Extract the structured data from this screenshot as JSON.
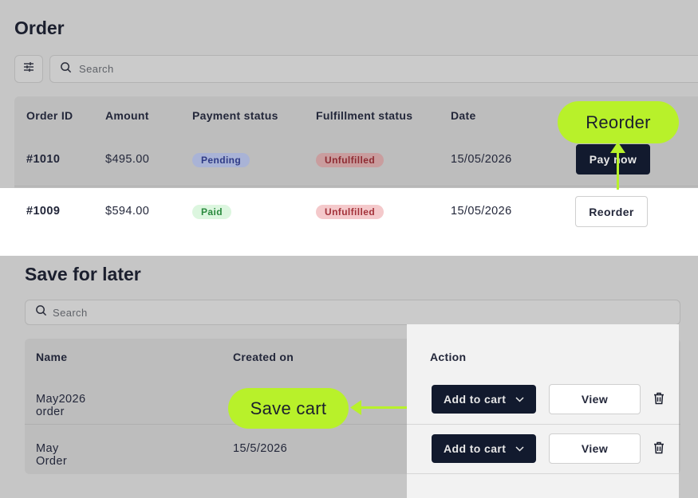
{
  "orders": {
    "title": "Order",
    "search_placeholder": "Search",
    "columns": [
      "Order ID",
      "Amount",
      "Payment status",
      "Fulfillment status",
      "Date"
    ],
    "rows": [
      {
        "id": "#1010",
        "amount": "$495.00",
        "payment": "Pending",
        "fulfillment": "Unfulfilled",
        "date": "15/05/2026",
        "action": "Pay now"
      },
      {
        "id": "#1009",
        "amount": "$594.00",
        "payment": "Paid",
        "fulfillment": "Unfulfilled",
        "date": "15/05/2026",
        "action": "Reorder"
      }
    ],
    "callout": "Reorder"
  },
  "saved": {
    "title": "Save for later",
    "search_placeholder": "Search",
    "columns": [
      "Name",
      "Created on",
      "Action"
    ],
    "rows": [
      {
        "name": "May2026 order",
        "created": "",
        "add_label": "Add to cart",
        "view_label": "View"
      },
      {
        "name": "May Order",
        "created": "15/5/2026",
        "add_label": "Add to cart",
        "view_label": "View"
      }
    ],
    "callout": "Save cart"
  },
  "colors": {
    "callout": "#b8f12a",
    "dark_button": "#121a2e",
    "pending_bg": "#a9b3d6",
    "pending_fg": "#2e3a86",
    "paid_bg": "#dcf6df",
    "paid_fg": "#2a8a3e",
    "unfulfilled_bg": "#f4c9cb",
    "unfulfilled_fg": "#a3323a"
  },
  "icons": [
    "sliders-icon",
    "search-icon",
    "chevron-down-icon",
    "trash-icon"
  ]
}
